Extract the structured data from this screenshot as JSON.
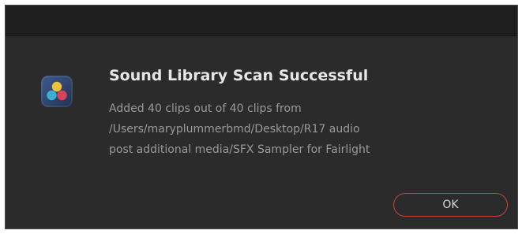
{
  "dialog": {
    "icon": "davinci-resolve-app-icon",
    "title": "Sound Library Scan Successful",
    "message_lines": [
      "Added 40 clips out of 40 clips from",
      "/Users/maryplummerbmd/Desktop/R17 audio",
      "post additional media/SFX Sampler for Fairlight"
    ],
    "ok_label": "OK",
    "colors": {
      "background": "#2b2b2b",
      "titlebar": "#1e1e1e",
      "title_text": "#e6e6e6",
      "message_text": "#9a9a9a",
      "ok_border": "#c0453a"
    }
  }
}
